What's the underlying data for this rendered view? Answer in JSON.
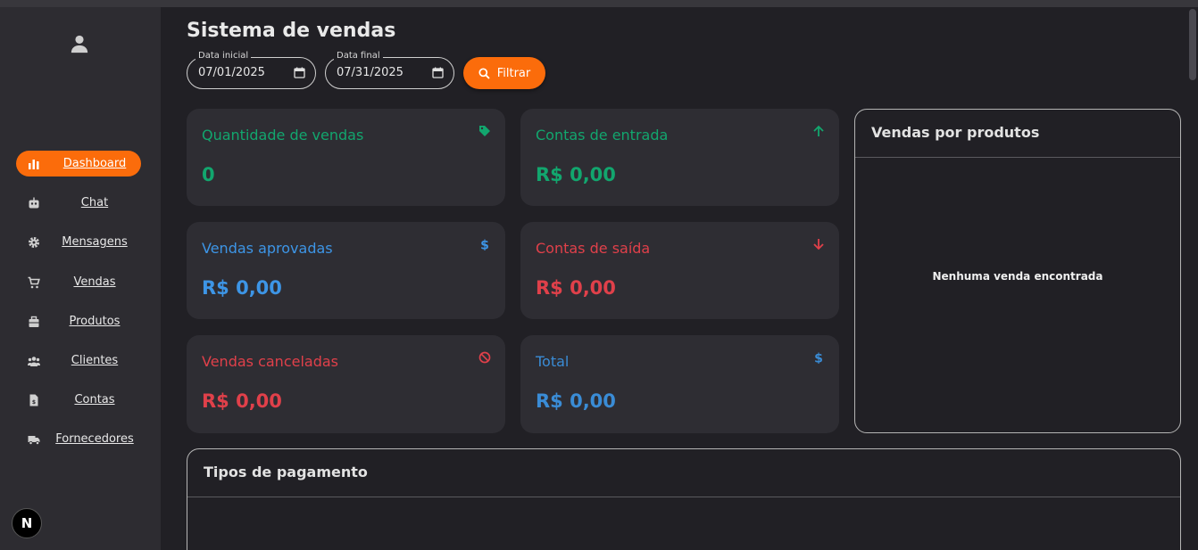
{
  "app": {
    "title": "Sistema de vendas"
  },
  "filters": {
    "start_label": "Data inicial",
    "start_value": "07/01/2025",
    "end_label": "Data final",
    "end_value": "07/31/2025",
    "filter_button": "Filtrar"
  },
  "sidebar": {
    "items": [
      {
        "label": "Dashboard",
        "icon": "bar-chart-icon",
        "active": true
      },
      {
        "label": "Chat",
        "icon": "robot-icon"
      },
      {
        "label": "Mensagens",
        "icon": "gear-icon"
      },
      {
        "label": "Vendas",
        "icon": "cart-icon"
      },
      {
        "label": "Produtos",
        "icon": "box-icon"
      },
      {
        "label": "Clientes",
        "icon": "users-icon"
      },
      {
        "label": "Contas",
        "icon": "invoice-icon"
      },
      {
        "label": "Fornecedores",
        "icon": "truck-icon"
      }
    ],
    "logo_letter": "N"
  },
  "cards": {
    "qtd_vendas": {
      "label": "Quantidade de vendas",
      "value": "0",
      "color": "#12a66e",
      "icon": "tag-icon"
    },
    "contas_entrada": {
      "label": "Contas de entrada",
      "value": "R$ 0,00",
      "color": "#12a66e",
      "icon": "arrow-up-icon"
    },
    "vendas_aprovadas": {
      "label": "Vendas aprovadas",
      "value": "R$ 0,00",
      "color": "#3d95e6",
      "icon": "dollar-icon"
    },
    "contas_saida": {
      "label": "Contas de saída",
      "value": "R$ 0,00",
      "color": "#e0404a",
      "icon": "arrow-down-icon"
    },
    "vendas_canceladas": {
      "label": "Vendas canceladas",
      "value": "R$ 0,00",
      "color": "#e0404a",
      "icon": "block-icon"
    },
    "total": {
      "label": "Total",
      "value": "R$ 0,00",
      "color": "#3a8cd6",
      "icon": "dollar-icon"
    }
  },
  "products_panel": {
    "title": "Vendas por produtos",
    "empty_text": "Nenhuma venda encontrada"
  },
  "payments_panel": {
    "title": "Tipos de pagamento"
  }
}
